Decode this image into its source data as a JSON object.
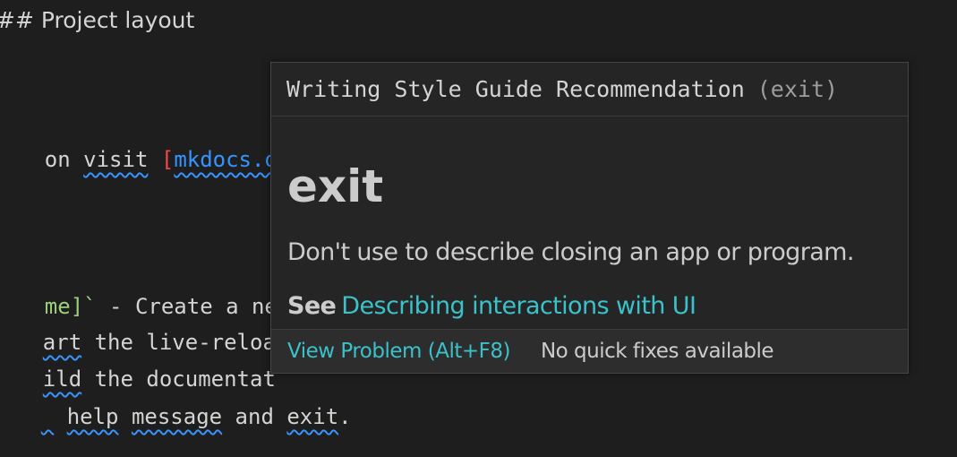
{
  "editor": {
    "heading": "## Project layout",
    "line_visit": {
      "prefix": "on ",
      "visit": "visit",
      "space": " ",
      "bracket": "[",
      "link": "mkdocs.or"
    },
    "line_create": {
      "code": "me]`",
      "rest": " - Create a ne"
    },
    "line_start": {
      "word": "art",
      "rest": " the live-reloa"
    },
    "line_build": {
      "word": "ild",
      "rest": " the documentat"
    },
    "line_help": {
      "pre": " ",
      "help": "help",
      "space1": " ",
      "message": "message",
      "and": " and ",
      "exit": "exit",
      "end": "."
    }
  },
  "hover": {
    "header_title": "Writing Style Guide Recommendation",
    "header_term": "(exit)",
    "title": "exit",
    "description": "Don't use to describe closing an app or program.",
    "see_label": "See",
    "see_link": "Describing interactions with UI",
    "view_problem": "View Problem (Alt+F8)",
    "no_fixes": "No quick fixes available"
  },
  "colors": {
    "background": "#1e1e1e",
    "hover_background": "#252526",
    "link": "#3bc1c9",
    "squiggle": "#3794ff"
  }
}
